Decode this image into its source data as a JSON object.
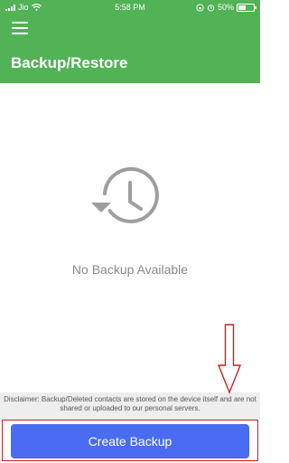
{
  "status_bar": {
    "carrier": "Jio",
    "time": "5:58 PM",
    "battery": "50%"
  },
  "header": {
    "title": "Backup/Restore"
  },
  "empty_state": {
    "message": "No Backup Available"
  },
  "disclaimer": {
    "text": "Disclaimer: Backup/Deleted contacts are stored on the device itself and are not shared or uploaded to our personal servers."
  },
  "actions": {
    "create_backup_label": "Create Backup"
  },
  "colors": {
    "header": "#52b256",
    "button": "#4a6cf0",
    "annotation": "#cc1f1f"
  },
  "icons": {
    "menu": "hamburger-menu-icon",
    "empty_state": "history-clock-icon"
  }
}
